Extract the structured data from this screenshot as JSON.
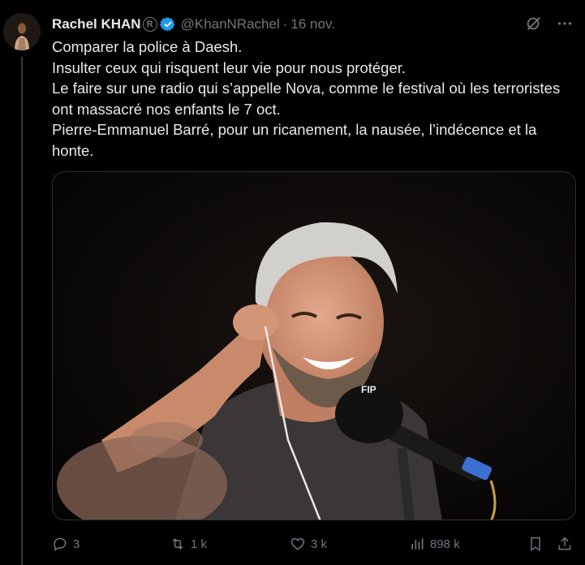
{
  "tweet": {
    "author_name": "Rachel KHAN",
    "handle": "@KhanNRachel",
    "separator": "·",
    "date": "16 nov.",
    "badge_letter": "R",
    "text_lines": [
      "Comparer la police à Daesh.",
      "Insulter ceux qui risquent leur vie pour nous protéger.",
      "Le faire sur une radio qui s’appelle Nova, comme le festival où les terroristes",
      "ont massacré nos enfants le 7 oct.",
      "Pierre-Emmanuel Barré, pour un ricanement, la nausée, l’indécence et la",
      "honte."
    ],
    "media_microphone_logo": "FIP"
  },
  "actions": {
    "replies": "3",
    "reposts": "1 k",
    "likes": "3 k",
    "views": "898 k"
  },
  "icons": {
    "verified": "verified-badge-icon",
    "grok": "grok-icon",
    "more": "more-icon",
    "reply": "reply-icon",
    "repost": "repost-icon",
    "like": "heart-icon",
    "views": "views-icon",
    "bookmark": "bookmark-icon",
    "share": "share-icon"
  },
  "colors": {
    "background": "#000000",
    "text": "#e7e9ea",
    "muted": "#71767b",
    "verified": "#1d9bf0"
  }
}
